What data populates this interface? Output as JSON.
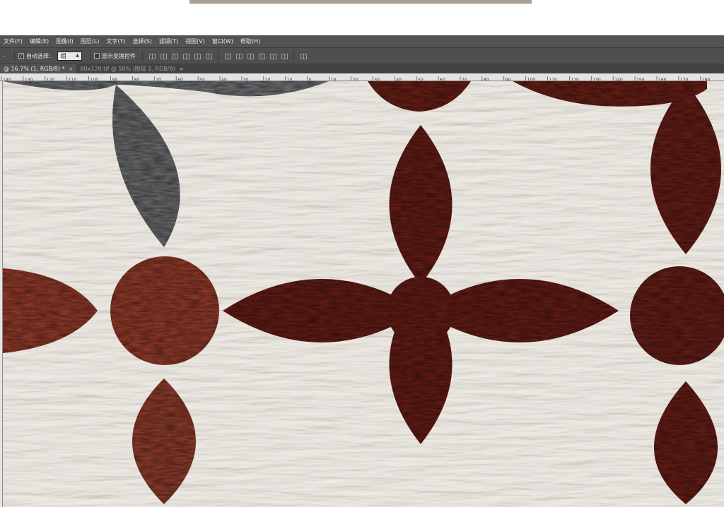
{
  "menubar": {
    "items": [
      "文件(F)",
      "编辑(E)",
      "图像(I)",
      "图层(L)",
      "文字(Y)",
      "选择(S)",
      "滤镜(T)",
      "视图(V)",
      "窗口(W)",
      "帮助(H)"
    ]
  },
  "options_bar": {
    "tool_dropdown": "-",
    "auto_select_label": "自动选择：",
    "auto_select_value": "组",
    "show_transform_label": "显示变换控件",
    "auto_select_checked": true,
    "show_transform_checked": false
  },
  "tabs": [
    {
      "label": "@ 16.7% (1, RGB/8) *",
      "close": "×",
      "active": true
    },
    {
      "label": "80x120.tif @ 50% (图层 1, RGB/8)",
      "close": "×",
      "active": false
    }
  ],
  "ruler": {
    "labels": [
      "140",
      "130",
      "120",
      "110",
      "100",
      "90",
      "80",
      "70",
      "60",
      "50",
      "40",
      "30",
      "20",
      "10",
      "0",
      "10",
      "20",
      "30",
      "40",
      "50",
      "60",
      "70",
      "80",
      "90",
      "100",
      "110",
      "120",
      "130",
      "140",
      "150",
      "160",
      "170",
      "180"
    ]
  },
  "colors": {
    "wall": "#c3bcb1",
    "dark_red": "#6a1f17",
    "rust": "#9a3e2c",
    "grey": "#6f7274",
    "ui_bg": "#535353"
  },
  "icons": {
    "tool_dropdown": "chevron-down-icon",
    "checkbox": "checkbox-icon",
    "align": "align-icon",
    "close": "close-icon"
  }
}
